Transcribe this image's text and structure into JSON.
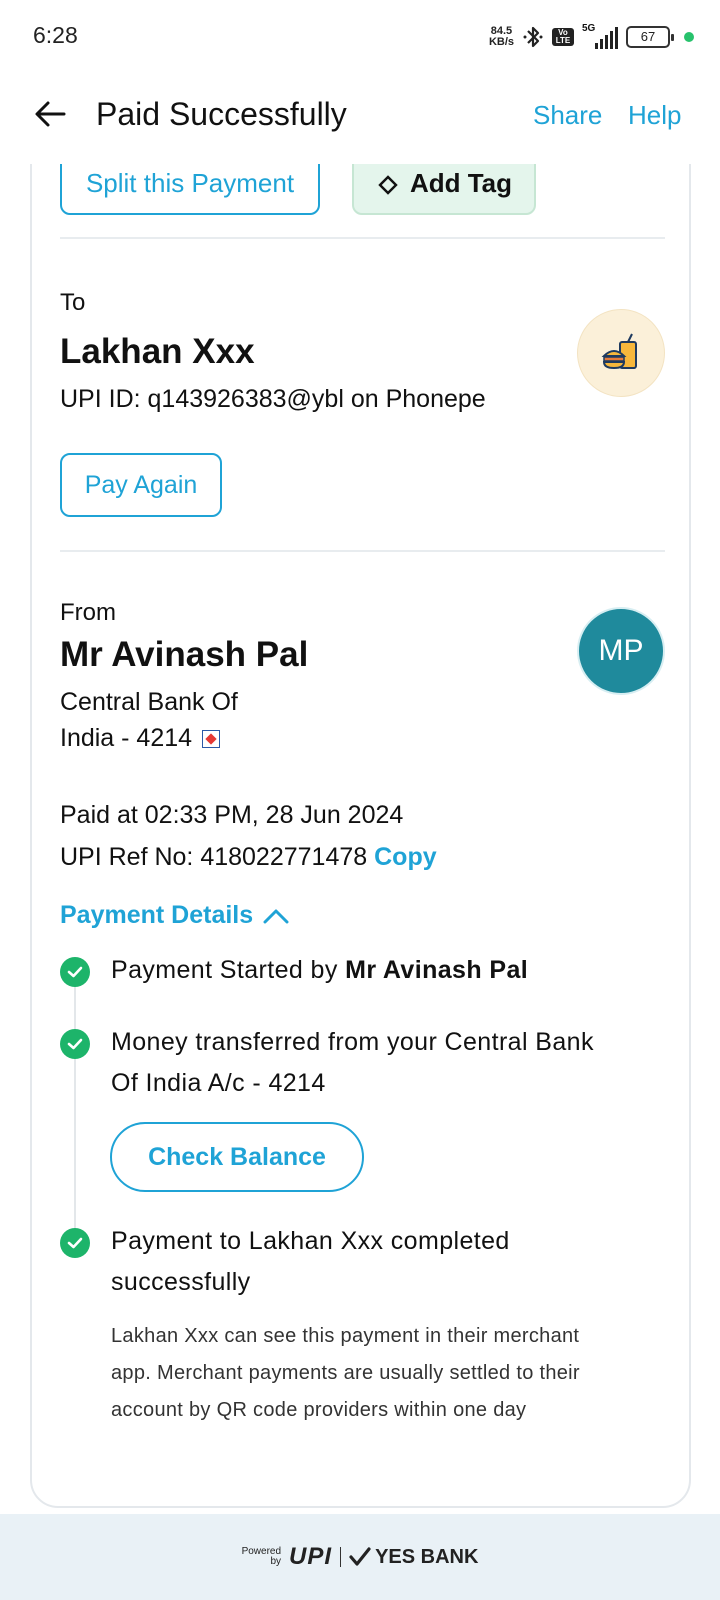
{
  "status_bar": {
    "time": "6:28",
    "net_speed_value": "84.5",
    "net_speed_unit": "KB/s",
    "volte_top": "Vo",
    "volte_bottom": "LTE",
    "network": "5G",
    "battery": "67"
  },
  "header": {
    "title": "Paid Successfully",
    "share": "Share",
    "help": "Help"
  },
  "actions": {
    "split_payment": "Split this Payment",
    "add_tag": "Add Tag"
  },
  "to": {
    "label": "To",
    "name": "Lakhan Xxx",
    "upi_id": "UPI ID: q143926383@ybl on Phonepe",
    "pay_again": "Pay Again"
  },
  "from": {
    "label": "From",
    "name": "Mr Avinash Pal",
    "avatar_initials": "MP",
    "bank_line1": "Central Bank Of",
    "bank_line2": "India - 4214"
  },
  "transaction": {
    "paid_at": "Paid at 02:33 PM, 28 Jun 2024",
    "ref_label": "UPI Ref No: 418022771478",
    "copy": "Copy"
  },
  "payment_details": {
    "title": "Payment Details",
    "step1_prefix": "Payment Started by",
    "step1_name": "Mr Avinash Pal",
    "step2_line1": "Money transferred from your Central Bank",
    "step2_line2": "Of India A/c - 4214",
    "check_balance": "Check Balance",
    "step3_line1": "Payment to Lakhan Xxx completed",
    "step3_line2": "successfully",
    "note_line1": "Lakhan Xxx can see this payment in their merchant",
    "note_line2": "app. Merchant payments are usually settled to their",
    "note_line3": "account by QR code providers within one day"
  },
  "footer": {
    "powered": "Powered",
    "by": "by",
    "upi": "UPI",
    "bank": "YES BANK"
  },
  "colors": {
    "accent": "#1fa3d6",
    "success": "#1db46a",
    "avatar": "#1f8a9c"
  }
}
